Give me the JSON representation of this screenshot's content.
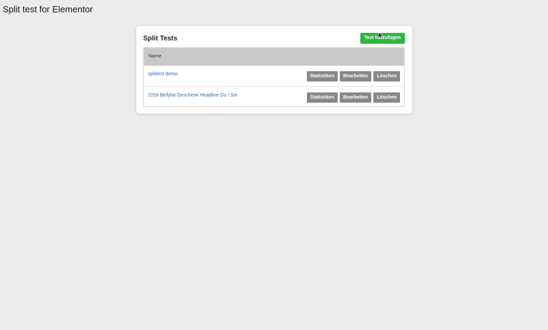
{
  "page": {
    "title": "Split test for Elementor"
  },
  "panel": {
    "title": "Split Tests",
    "add_button_label": "Test hinzufügen"
  },
  "table": {
    "column_name": "Name",
    "rows": [
      {
        "name": "splittest demo",
        "actions": [
          "Statistiken",
          "Bearbeiten",
          "Löschen"
        ]
      },
      {
        "name": "2209 Bellyfat Geschenk Headline Du / Sie",
        "actions": [
          "Statistiken",
          "Bearbeiten",
          "Löschen"
        ]
      }
    ]
  },
  "colors": {
    "background": "#ececec",
    "accent_green": "#2db742",
    "action_gray": "#888888",
    "link_blue": "#2f6db5",
    "header_gray": "#c9c9c9"
  },
  "icons": {
    "cursor": "mouse-pointer-icon"
  }
}
